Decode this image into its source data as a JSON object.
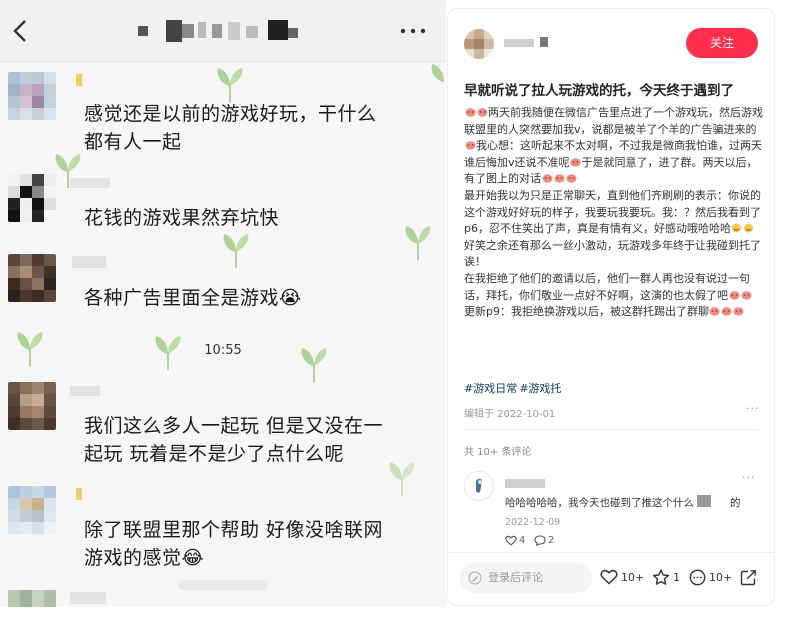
{
  "chat": {
    "time": "10:55",
    "messages": [
      {
        "text": "感觉还是以前的游戏好玩，干什么都有人一起"
      },
      {
        "text": "花钱的游戏果然弃坑快"
      },
      {
        "text": "各种广告里面全是游戏😭"
      },
      {
        "text": "我们这么多人一起玩 但是又没在一起玩 玩着是不是少了点什么呢"
      },
      {
        "text": "除了联盟里那个帮助 好像没啥联网游戏的感觉😂"
      }
    ]
  },
  "post": {
    "follow_label": "关注",
    "title": "早就听说了拉人玩游戏的托，今天终于遇到了",
    "body": [
      "两天前我随便在微信广告里点进了一个游戏玩，然后游戏联盟里的人突然要加我v，说都是被羊了个羊的广告骗进来的",
      "我心想：这听起来不太对啊，不过我是微商我怕谁，过两天谁后悔加v还说不准呢",
      "于是就同意了，进了群。两天以后，有了图上的对话",
      "最开始我以为只是正常聊天，直到他们齐刷刷的表示：你说的这个游戏好好玩的样子，我要玩我要玩。我：？然后我看到了p6，忍不住笑出了声，真是有情有义，好感动哦哈哈哈",
      "好笑之余还有那么一丝小激动，玩游戏多年终于让我碰到托了诶！",
      "在我拒绝了他们的邀请以后，他们一群人再也没有说过一句话，拜托，你们敬业一点好不好啊，这演的也太假了吧",
      "更新p9：我拒绝换游戏以后，被这群托踢出了群聊"
    ],
    "tags": [
      "#游戏日常",
      "#游戏托"
    ],
    "edit_date": "编辑于 2022-10-01",
    "comment_count": "共 10+ 条评论",
    "comment": {
      "text": "哈哈哈哈哈，我今天也碰到了推这个什么",
      "text_end": "的",
      "date": "2022-12-09",
      "likes": "4",
      "replies": "2"
    },
    "input_placeholder": "登录后评论",
    "likes": "10+",
    "collects": "1",
    "comments": "10+"
  },
  "colors": {
    "accent": "#ff2e4d",
    "tag": "#13386c",
    "sprout": "#a8cf8f"
  },
  "icons": [
    "back-icon",
    "more-icon",
    "pig-icon",
    "heart-icon",
    "star-icon",
    "comment-icon",
    "share-icon",
    "pen-icon"
  ]
}
